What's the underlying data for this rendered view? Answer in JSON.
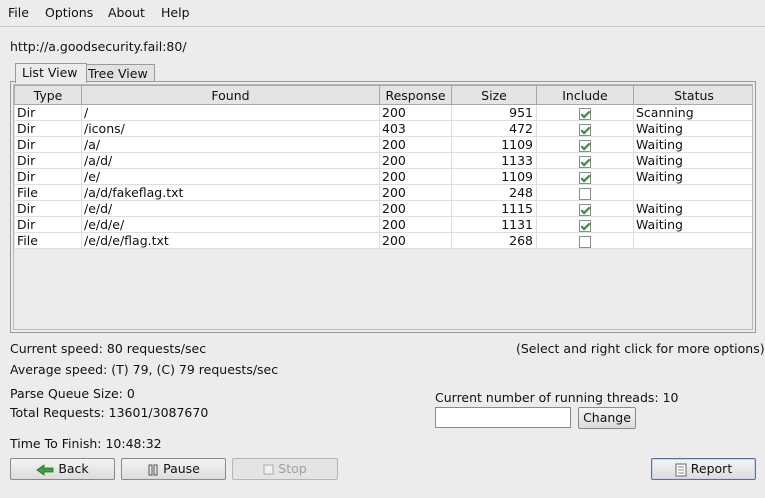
{
  "menu": [
    "File",
    "Options",
    "About",
    "Help"
  ],
  "url": "http://a.goodsecurity.fail:80/",
  "tabs": [
    {
      "label": "List View",
      "active": true
    },
    {
      "label": "Tree View",
      "active": false
    }
  ],
  "table": {
    "columns": [
      "Type",
      "Found",
      "Response",
      "Size",
      "Include",
      "Status"
    ],
    "rows": [
      {
        "type": "Dir",
        "found": "/",
        "response": "200",
        "size": "951",
        "include": true,
        "status": "Scanning"
      },
      {
        "type": "Dir",
        "found": "/icons/",
        "response": "403",
        "size": "472",
        "include": true,
        "status": "Waiting"
      },
      {
        "type": "Dir",
        "found": "/a/",
        "response": "200",
        "size": "1109",
        "include": true,
        "status": "Waiting"
      },
      {
        "type": "Dir",
        "found": "/a/d/",
        "response": "200",
        "size": "1133",
        "include": true,
        "status": "Waiting"
      },
      {
        "type": "Dir",
        "found": "/e/",
        "response": "200",
        "size": "1109",
        "include": true,
        "status": "Waiting"
      },
      {
        "type": "File",
        "found": "/a/d/fakeflag.txt",
        "response": "200",
        "size": "248",
        "include": false,
        "status": ""
      },
      {
        "type": "Dir",
        "found": "/e/d/",
        "response": "200",
        "size": "1115",
        "include": true,
        "status": "Waiting"
      },
      {
        "type": "Dir",
        "found": "/e/d/e/",
        "response": "200",
        "size": "1131",
        "include": true,
        "status": "Waiting"
      },
      {
        "type": "File",
        "found": "/e/d/e/flag.txt",
        "response": "200",
        "size": "268",
        "include": false,
        "status": ""
      }
    ]
  },
  "stats": {
    "current_speed": "Current speed: 80 requests/sec",
    "hint": "(Select and right click for more options)",
    "average_speed": "Average speed: (T) 79, (C) 79 requests/sec",
    "parse_queue": "Parse Queue Size: 0",
    "total_requests": "Total Requests: 13601/3087670",
    "time_to_finish": "Time To Finish: 10:48:32",
    "threads_label": "Current number of running threads: 10"
  },
  "threads_input": {
    "value": ""
  },
  "buttons": {
    "back": "Back",
    "pause": "Pause",
    "stop": "Stop",
    "change": "Change",
    "report": "Report"
  },
  "icons": {
    "back": "green-left-arrow-icon",
    "pause": "pause-icon",
    "stop": "stop-icon",
    "report": "document-icon"
  },
  "colors": {
    "check": "#2f8a2f",
    "back_arrow": "#3aa63a"
  }
}
